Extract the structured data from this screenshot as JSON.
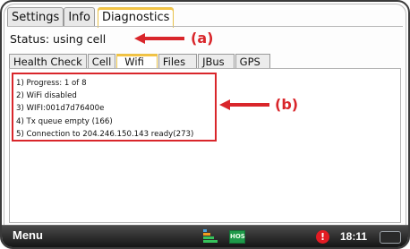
{
  "top_tabs": [
    {
      "label": "Settings",
      "active": false
    },
    {
      "label": "Info",
      "active": false
    },
    {
      "label": "Diagnostics",
      "active": true
    }
  ],
  "status_text": "Status: using cell",
  "annotations": {
    "a": "(a)",
    "b": "(b)",
    "color": "#d9262b"
  },
  "sub_tabs": [
    {
      "label": "Health Check",
      "active": false
    },
    {
      "label": "Cell",
      "active": false
    },
    {
      "label": "Wifi",
      "active": true
    },
    {
      "label": "Files",
      "active": false
    },
    {
      "label": "JBus",
      "active": false
    },
    {
      "label": "GPS",
      "active": false
    }
  ],
  "log_items": [
    "1)  Progress: 1 of 8",
    "2)  WiFi disabled",
    "3)  WIFI:001d7d76400e",
    "4)  Tx queue empty (166)",
    "5)  Connection to 204.246.150.143 ready(273)"
  ],
  "bottom_bar": {
    "menu_label": "Menu",
    "hos_label": "HOS",
    "alert_glyph": "!",
    "clock": "18:11"
  }
}
